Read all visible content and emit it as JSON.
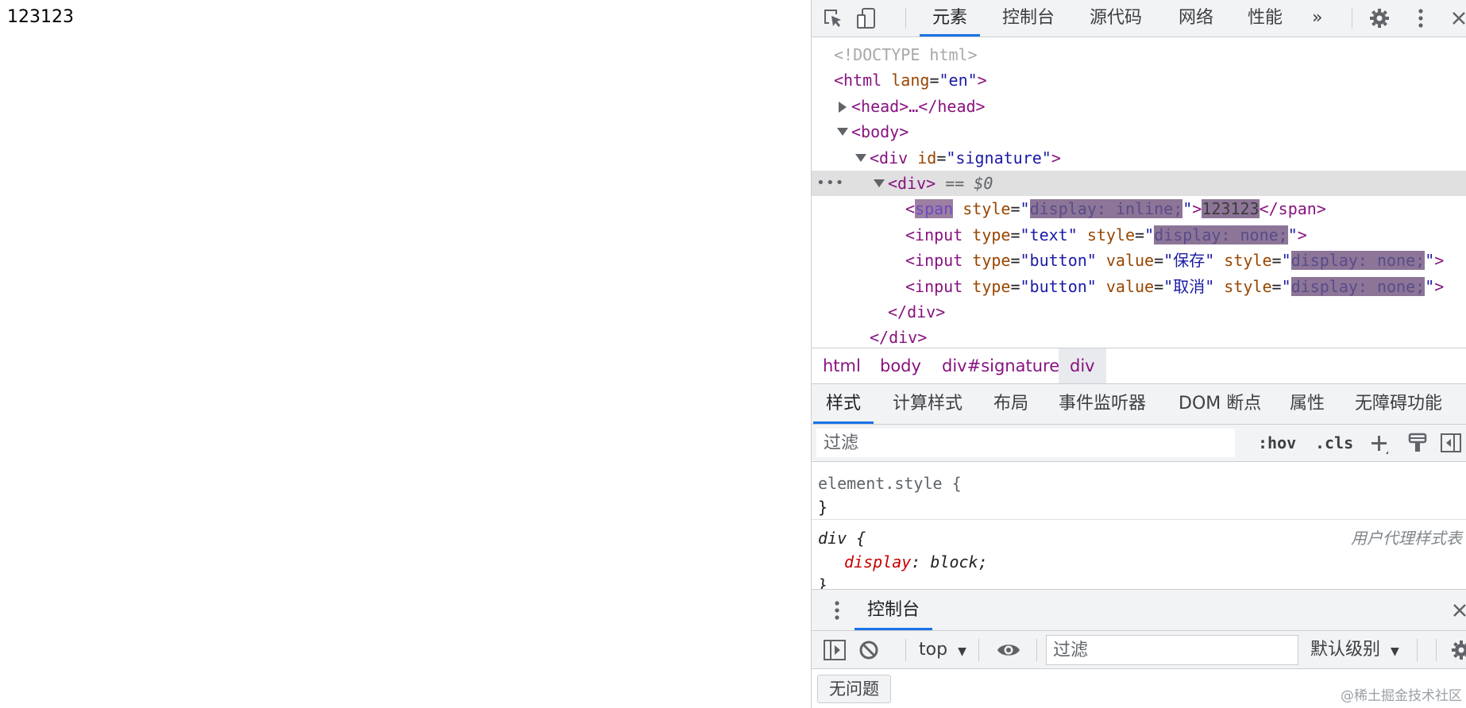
{
  "page": {
    "text": "123123"
  },
  "devtools": {
    "tabs": [
      "元素",
      "控制台",
      "源代码",
      "网络",
      "性能"
    ],
    "more_tabs": "»",
    "dom": {
      "doctype": "<!DOCTYPE html>",
      "html_tag": "html",
      "html_attr": "lang",
      "html_val": "\"en\"",
      "head": "<head>…</head>",
      "body_tag": "body",
      "div_tag": "div",
      "div_attr": "id",
      "div_val": "\"signature\"",
      "sel_marker": "== $0",
      "span_tag": "span",
      "span_attr": "style",
      "span_style": "display: inline;",
      "span_text": "123123",
      "input1_type": "\"text\"",
      "input_none": "display: none;",
      "input2_value": "\"保存\"",
      "input3_value": "\"取消\"",
      "btn_type": "\"button\""
    },
    "breadcrumbs": [
      "html",
      "body",
      "div#signature",
      "div"
    ],
    "style_tabs": [
      "样式",
      "计算样式",
      "布局",
      "事件监听器",
      "DOM 断点",
      "属性",
      "无障碍功能"
    ],
    "filter_placeholder": "过滤",
    "filter_hov": ":hov",
    "filter_cls": ".cls",
    "rules": {
      "element_style": "element.style {",
      "close": "}",
      "div_selector": "div {",
      "prop": "display",
      "value": "block;",
      "ua_label": "用户代理样式表"
    },
    "drawer": {
      "tab": "控制台",
      "context": "top",
      "filter_placeholder": "过滤",
      "level": "默认级别",
      "issues": "无问题"
    },
    "watermark": "@稀土掘金技术社区"
  }
}
